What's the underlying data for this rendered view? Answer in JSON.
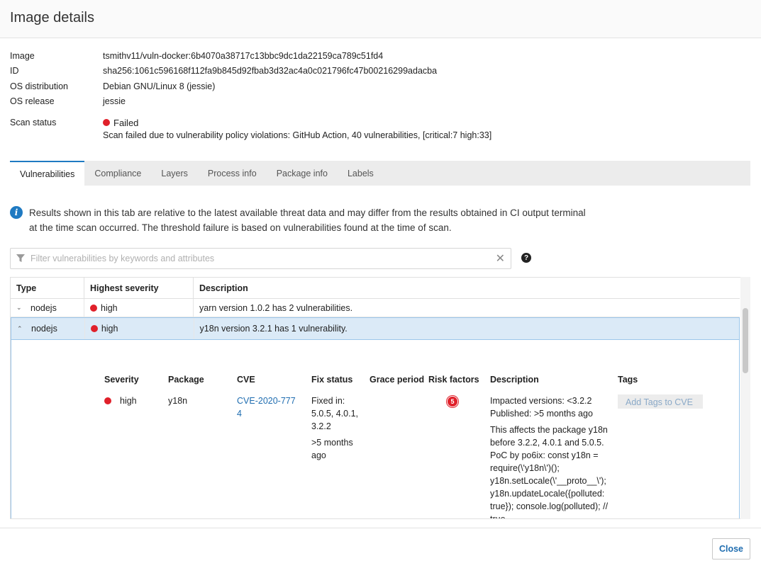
{
  "header": {
    "title": "Image details"
  },
  "meta": [
    {
      "label": "Image",
      "value": "tsmithv11/vuln-docker:6b4070a38717c13bbc9dc1da22159ca789c51fd4"
    },
    {
      "label": "ID",
      "value": "sha256:1061c596168f112fa9b845d92fbab3d32ac4a0c021796fc47b00216299adacba"
    },
    {
      "label": "OS distribution",
      "value": "Debian GNU/Linux 8 (jessie)"
    },
    {
      "label": "OS release",
      "value": "jessie"
    }
  ],
  "scan": {
    "label": "Scan status",
    "status": "Failed",
    "status_color": "#e0202a",
    "message": "Scan failed due to vulnerability policy violations: GitHub Action, 40 vulnerabilities, [critical:7 high:33]"
  },
  "tabs": [
    {
      "label": "Vulnerabilities",
      "active": true
    },
    {
      "label": "Compliance"
    },
    {
      "label": "Layers"
    },
    {
      "label": "Process info"
    },
    {
      "label": "Package info"
    },
    {
      "label": "Labels"
    }
  ],
  "info": {
    "icon": "info-icon",
    "line1": "Results shown in this tab are relative to the latest available threat data and may differ from the results obtained in CI output terminal",
    "line2": "at the time scan occurred. The threshold failure is based on vulnerabilities found at the time of scan."
  },
  "filter": {
    "placeholder": "Filter vulnerabilities by keywords and attributes",
    "value": "",
    "clear": "✕",
    "help": "?"
  },
  "table": {
    "headers": {
      "type": "Type",
      "severity": "Highest severity",
      "description": "Description"
    },
    "rows": [
      {
        "chevron": "⌄",
        "type": "nodejs",
        "severity": "high",
        "description": "yarn version 1.0.2 has 2 vulnerabilities."
      },
      {
        "chevron": "⌃",
        "type": "nodejs",
        "severity": "high",
        "description": "y18n version 3.2.1 has 1 vulnerability."
      }
    ],
    "expanded": {
      "headers": {
        "severity": "Severity",
        "package": "Package",
        "cve": "CVE",
        "fix_status": "Fix status",
        "grace": "Grace period",
        "risk": "Risk factors",
        "description": "Description",
        "tags": "Tags"
      },
      "row": {
        "severity": "high",
        "package": "y18n",
        "cve_line1": "CVE-2020-777",
        "cve_line2": "4",
        "fix_line1": "Fixed in:",
        "fix_line2": "5.0.5, 4.0.1,",
        "fix_line3": "3.2.2",
        "fix_age1": ">5 months",
        "fix_age2": "ago",
        "risk_count": "5",
        "desc_impacted": "Impacted versions: <3.2.2",
        "desc_published": "Published: >5 months ago",
        "desc_lines": [
          "This affects the package y18n",
          "before 3.2.2, 4.0.1 and 5.0.5.",
          "PoC by po6ix: const y18n =",
          "require(\\'y18n\\')();",
          "y18n.setLocale(\\'__proto__\\');",
          "y18n.updateLocale({polluted:",
          "true}); console.log(polluted); //",
          "true"
        ],
        "tag_button": "Add Tags to CVE"
      }
    }
  },
  "footer": {
    "close_label": "Close"
  }
}
